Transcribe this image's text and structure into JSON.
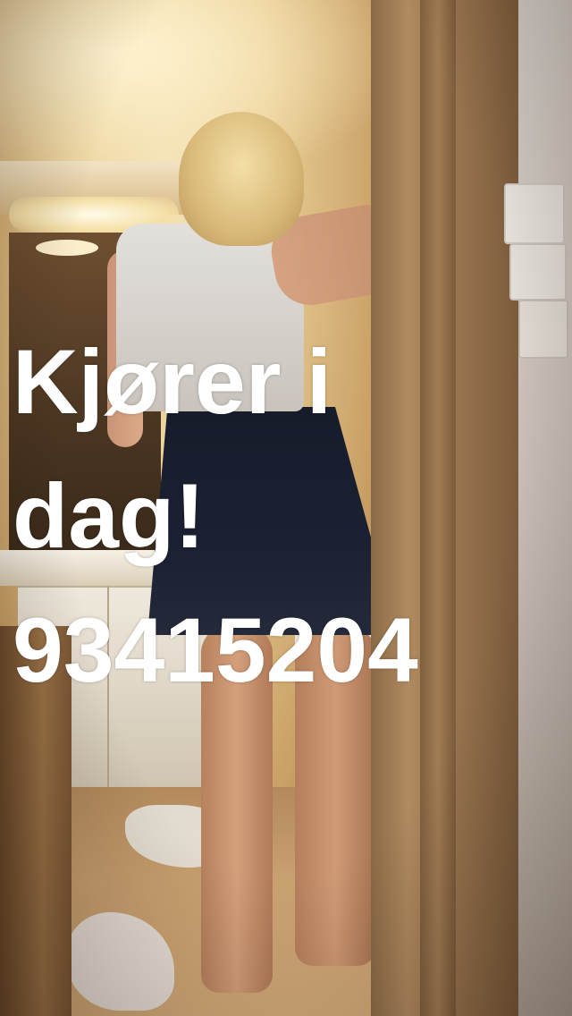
{
  "caption": {
    "lines": [
      "Kjører i",
      "dag!",
      "93415204"
    ],
    "color": "#ffffff"
  }
}
